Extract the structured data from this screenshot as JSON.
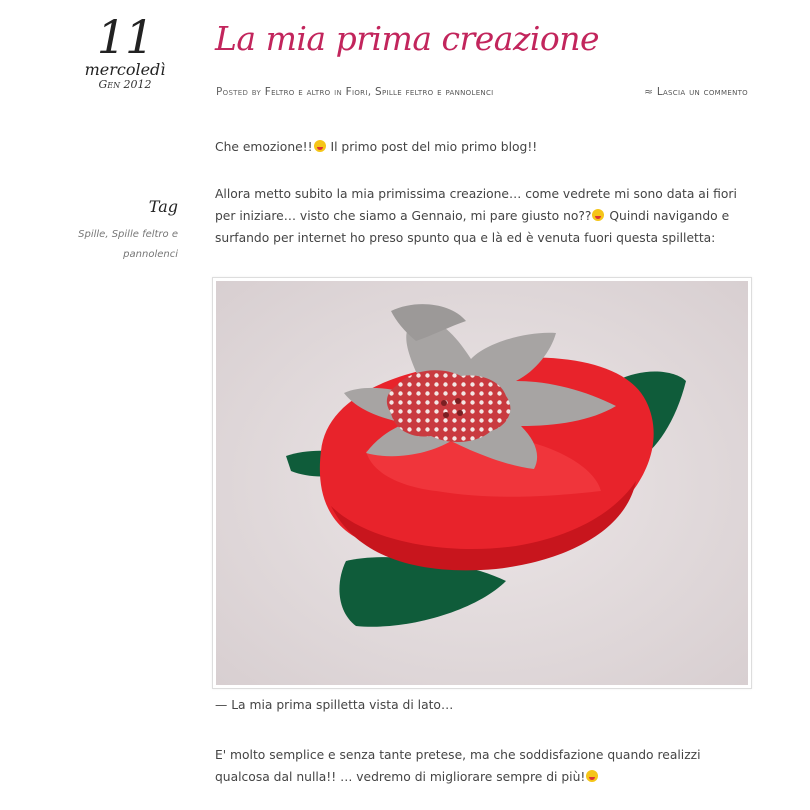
{
  "date": {
    "day": "11",
    "weekday": "mercoledì",
    "month_year": "Gen 2012"
  },
  "tags": {
    "title": "Tag",
    "items": [
      "Spille",
      "Spille feltro e pannolenci"
    ]
  },
  "post": {
    "title": "La mia prima creazione",
    "meta": {
      "posted_by_prefix": "Posted by",
      "author": "Feltro e altro",
      "in_label": "in",
      "category1": "Fiori",
      "category2": "Spille feltro e pannolenci",
      "comment_link": "≈ Lascia un commento"
    },
    "paragraph1": {
      "before": "Che emozione!!",
      "after": " Il primo post del mio primo blog!!"
    },
    "paragraph2": {
      "before": "Allora metto subito la mia primissima creazione… come vedrete mi sono data ai fiori per iniziare… visto che siamo a Gennaio, mi pare giusto no??",
      "after": "  Quindi navigando e surfando per internet ho preso spunto qua e là ed è venuta fuori questa spilletta:"
    },
    "image": {
      "colors": {
        "background": "#e8e1e2",
        "red_felt": "#e8232b",
        "grey_felt": "#a7a4a3",
        "green_felt": "#0f5c3a",
        "button_red": "#c93a3f",
        "button_dots": "#f3e6e4"
      }
    },
    "caption": "— La mia prima spilletta vista di lato…",
    "paragraph3": {
      "before": "E' molto semplice e senza tante pretese, ma che soddisfazione quando realizzi qualcosa dal nulla!! … vedremo di migliorare sempre di più!"
    },
    "emoji_icon": "tongue-smiley-icon"
  }
}
